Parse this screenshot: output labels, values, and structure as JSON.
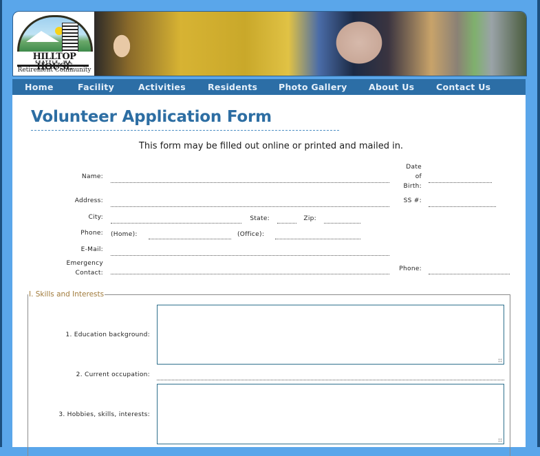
{
  "header": {
    "logo": {
      "name": "HILLTOP HOUSE",
      "location": "SEATTLE, WA",
      "tagline": "Retirement Community"
    }
  },
  "nav": {
    "items": [
      {
        "label": "Home"
      },
      {
        "label": "Facility"
      },
      {
        "label": "Activities"
      },
      {
        "label": "Residents"
      },
      {
        "label": "Photo Gallery"
      },
      {
        "label": "About Us"
      },
      {
        "label": "Contact Us"
      }
    ]
  },
  "page": {
    "title": "Volunteer Application Form",
    "intro": "This form may be filled out online or printed and mailed in."
  },
  "form": {
    "name_label": "Name:",
    "dob_label_1": "Date",
    "dob_label_2": "of",
    "dob_label_3": "Birth:",
    "address_label": "Address:",
    "ssn_label": "SS #:",
    "city_label": "City:",
    "state_label": "State:",
    "zip_label": "Zip:",
    "phone_label": "Phone:",
    "home_label": "(Home):",
    "office_label": "(Office):",
    "email_label": "E-Mail:",
    "emergency_label_1": "Emergency",
    "emergency_label_2": "Contact:",
    "emergency_phone_label": "Phone:"
  },
  "skills": {
    "legend": "I. Skills and Interests",
    "q1": "1. Education background:",
    "q2": "2. Current occupation:",
    "q3": "3. Hobbies, skills, interests:"
  },
  "colors": {
    "frame": "#5aa6ea",
    "nav": "#2c6ea6",
    "title": "#2d6ea3",
    "legend": "#a07a3a"
  }
}
